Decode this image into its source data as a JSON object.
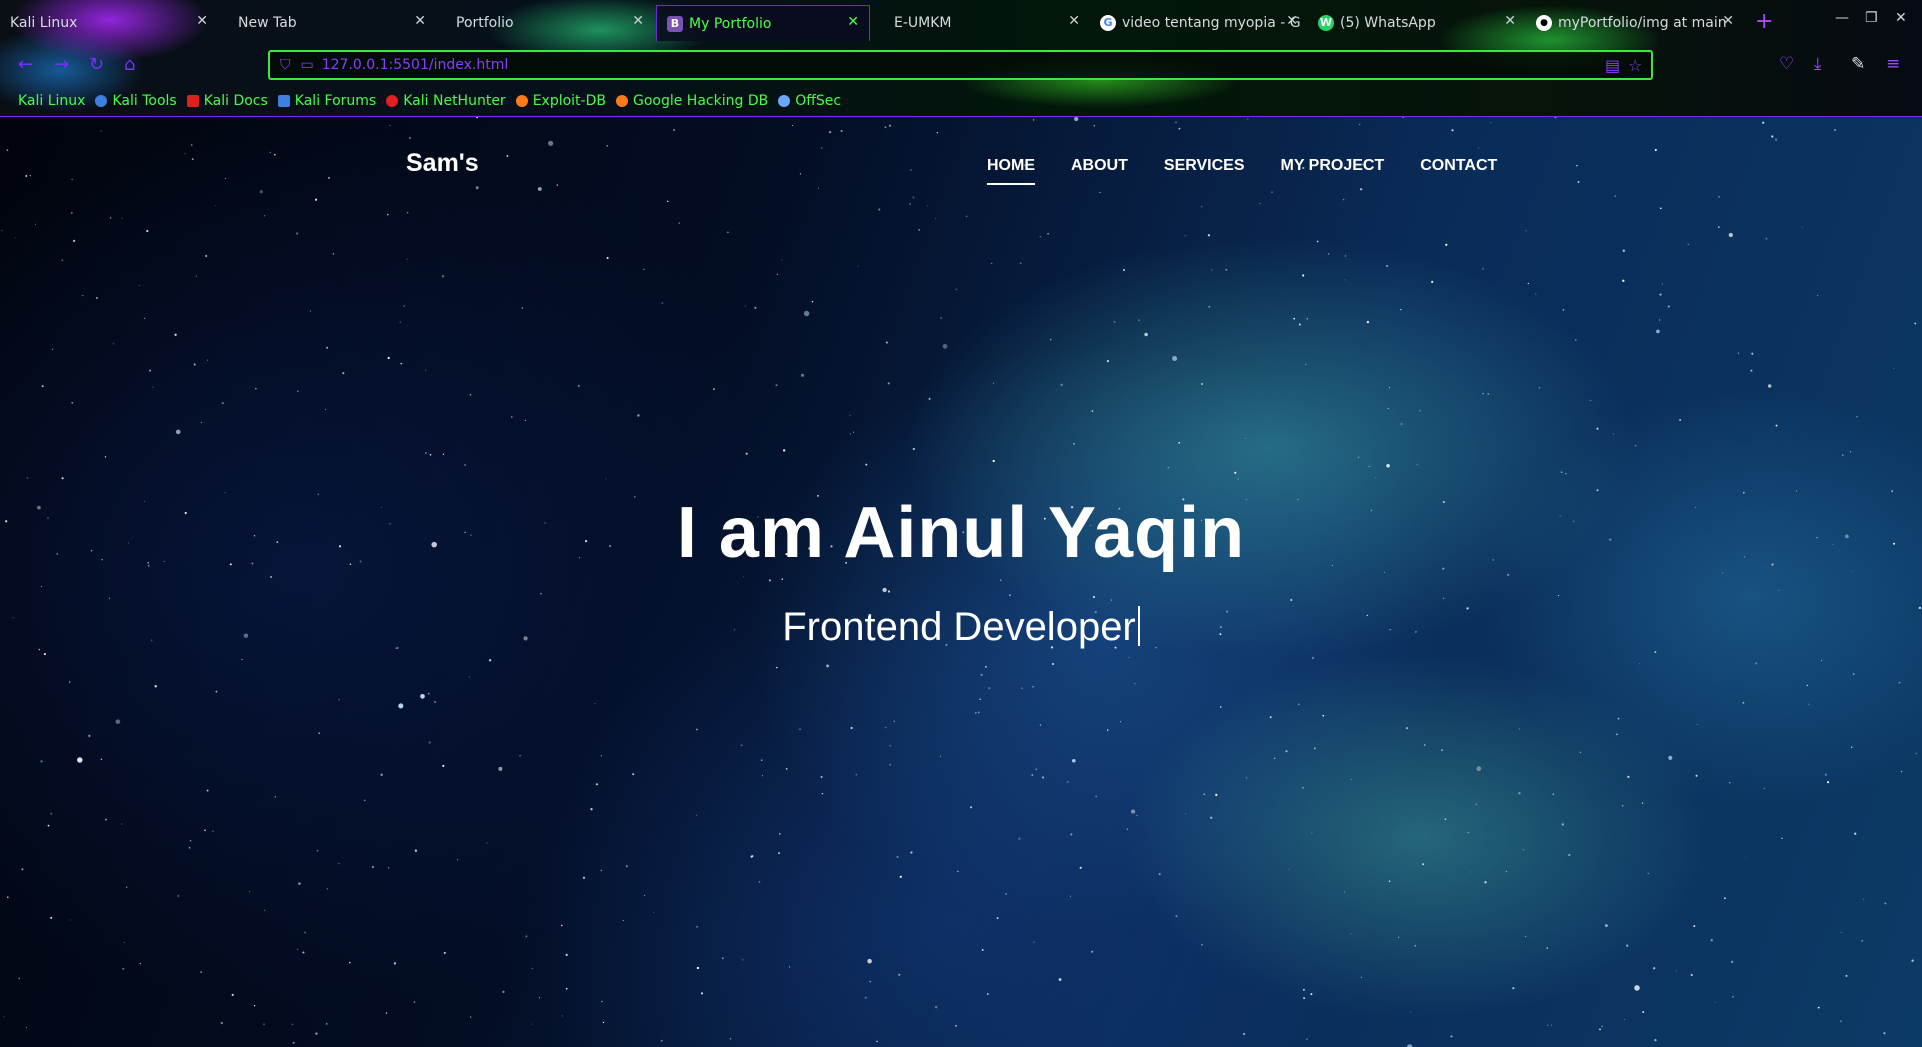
{
  "browser": {
    "tabs": [
      {
        "title": "Kali Linux",
        "favicon": "",
        "favicon_color": "",
        "active": false
      },
      {
        "title": "New Tab",
        "favicon": "",
        "favicon_color": "",
        "active": false
      },
      {
        "title": "Portfolio",
        "favicon": "",
        "favicon_color": "",
        "active": false
      },
      {
        "title": "My Portfolio",
        "favicon": "B",
        "favicon_color": "#7952b3",
        "active": true
      },
      {
        "title": "E-UMKM",
        "favicon": "",
        "favicon_color": "",
        "active": false
      },
      {
        "title": "video tentang myopia - G",
        "favicon": "G",
        "favicon_color": "#ffffff",
        "active": false
      },
      {
        "title": "(5) WhatsApp",
        "favicon": "W",
        "favicon_color": "#25d366",
        "active": false
      },
      {
        "title": "myPortfolio/img at main",
        "favicon": "gh",
        "favicon_color": "#ffffff",
        "active": false
      }
    ],
    "url": "127.0.0.1:5501/index.html",
    "bookmarks": [
      {
        "label": "Kali Linux",
        "icon_color": ""
      },
      {
        "label": "Kali Tools",
        "icon_color": "#3f7fe0"
      },
      {
        "label": "Kali Docs",
        "icon_color": "#e02020"
      },
      {
        "label": "Kali Forums",
        "icon_color": "#3f7fe0"
      },
      {
        "label": "Kali NetHunter",
        "icon_color": "#e02020"
      },
      {
        "label": "Exploit-DB",
        "icon_color": "#ff7a1a"
      },
      {
        "label": "Google Hacking DB",
        "icon_color": "#ff7a1a"
      },
      {
        "label": "OffSec",
        "icon_color": "#6aa6ff"
      }
    ],
    "accent_green": "#44ff44",
    "accent_purple": "#8a3dff"
  },
  "site": {
    "logo": "Sam's",
    "nav": [
      {
        "label": "HOME",
        "active": true
      },
      {
        "label": "ABOUT",
        "active": false
      },
      {
        "label": "SERVICES",
        "active": false
      },
      {
        "label": "MY PROJECT",
        "active": false
      },
      {
        "label": "CONTACT",
        "active": false
      }
    ],
    "hero": {
      "title": "I am Ainul Yaqin",
      "subtitle": "Frontend Developer"
    }
  }
}
